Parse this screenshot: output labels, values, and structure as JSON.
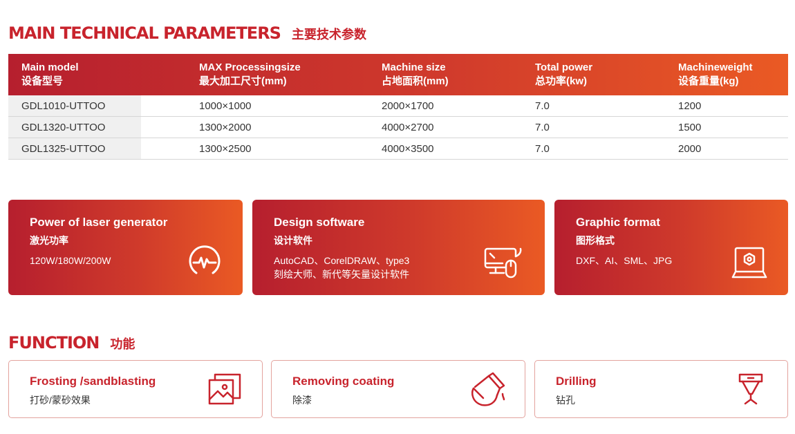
{
  "params_section": {
    "title_en": "MAIN TECHNICAL PARAMETERS",
    "title_cn": "主要技术参数"
  },
  "table": {
    "headers": [
      {
        "en": "Main model",
        "cn": "设备型号"
      },
      {
        "en": "MAX Processingsize",
        "cn": "最大加工尺寸(mm)"
      },
      {
        "en": "Machine size",
        "cn": "占地面积(mm)"
      },
      {
        "en": "Total power",
        "cn": "总功率(kw)"
      },
      {
        "en": "Machineweight",
        "cn": "设备重量(kg)"
      }
    ],
    "rows": [
      [
        "GDL1010-UTTOO",
        "1000×1000",
        "2000×1700",
        "7.0",
        "1200"
      ],
      [
        "GDL1320-UTTOO",
        "1300×2000",
        "4000×2700",
        "7.0",
        "1500"
      ],
      [
        "GDL1325-UTTOO",
        "1300×2500",
        "4000×3500",
        "7.0",
        "2000"
      ]
    ]
  },
  "features": [
    {
      "title": "Power of laser generator",
      "subtitle": "激光功率",
      "desc1": "120W/180W/200W",
      "desc2": "",
      "icon": "pulse-gauge-icon"
    },
    {
      "title": "Design software",
      "subtitle": "设计软件",
      "desc1": "AutoCAD、CorelDRAW、type3",
      "desc2": "刻绘大师、新代等矢量设计软件",
      "icon": "computer-mouse-icon"
    },
    {
      "title": "Graphic format",
      "subtitle": "图形格式",
      "desc1": "DXF、AI、SML、JPG",
      "desc2": "",
      "icon": "laptop-hexagon-icon"
    }
  ],
  "function_section": {
    "title_en": "FUNCTION",
    "title_cn": "功能"
  },
  "functions": [
    {
      "title": "Frosting /sandblasting",
      "subtitle": "打砂/蒙砂效果",
      "icon": "image-stack-icon"
    },
    {
      "title": "Removing coating",
      "subtitle": "除漆",
      "icon": "paint-pour-icon"
    },
    {
      "title": "Drilling",
      "subtitle": "钻孔",
      "icon": "laser-head-icon"
    }
  ],
  "colors": {
    "accent": "#c8232c",
    "gradient_start": "#b61f2e",
    "gradient_end": "#ea5a24",
    "row_shade": "#f0f0f0"
  }
}
